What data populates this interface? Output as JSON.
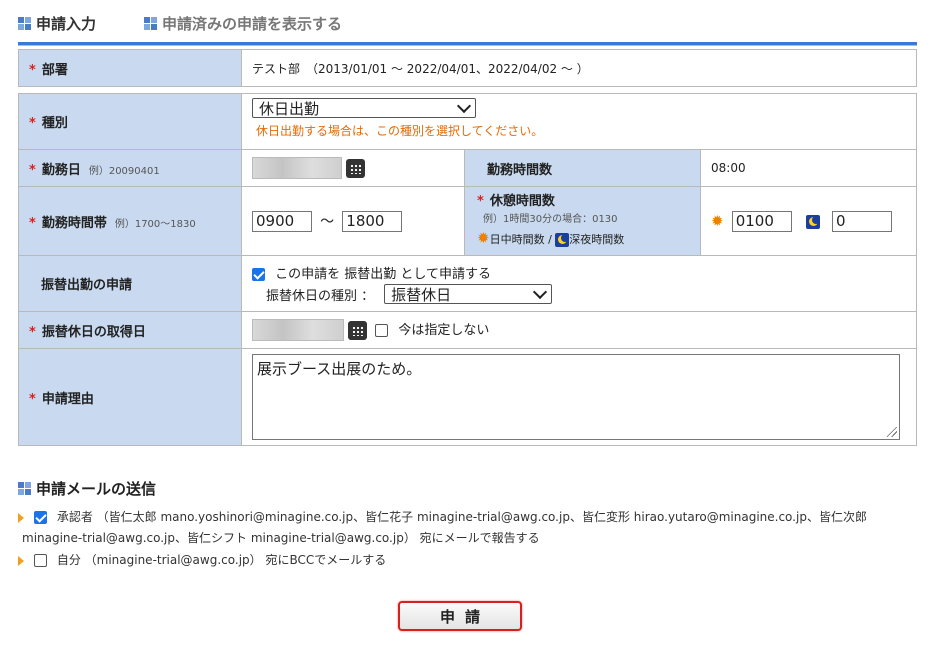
{
  "tabs": {
    "input": "申請入力",
    "submitted": "申請済みの申請を表示する"
  },
  "dept": {
    "label": "部署",
    "value": "テスト部　（2013/01/01 ～ 2022/04/01、2022/04/02 ～ ）"
  },
  "kind": {
    "label": "種別",
    "selected": "休日出勤",
    "note": "休日出勤する場合は、この種別を選択してください。"
  },
  "workday": {
    "label": "勤務日",
    "hint": "例）20090401"
  },
  "workhours": {
    "label": "勤務時間数",
    "value": "08:00"
  },
  "timeband": {
    "label": "勤務時間帯",
    "hint": "例）1700～1830",
    "start": "0900",
    "sep": "～",
    "end": "1800"
  },
  "break": {
    "label": "休憩時間数",
    "hint": "例）1時間30分の場合：0130",
    "day_label": "日中時間数",
    "slash": "/",
    "night_label": "深夜時間数",
    "day_value": "0100",
    "night_value": "0"
  },
  "substitute": {
    "label": "振替出勤の申請",
    "check_text": "この申請を 振替出勤 として申請する",
    "kind_label": "振替休日の種別 ：",
    "kind_value": "振替休日"
  },
  "subday": {
    "label": "振替休日の取得日",
    "no_specify": "今は指定しない"
  },
  "reason": {
    "label": "申請理由",
    "value": "展示ブース出展のため。"
  },
  "mail": {
    "title": "申請メールの送信",
    "approver_line1": "承認者 （皆仁太郎 mano.yoshinori@minagine.co.jp、皆仁花子 minagine-trial@awg.co.jp、皆仁変形 hirao.yutaro@minagine.co.jp、皆仁次郎",
    "approver_line2": "minagine-trial@awg.co.jp、皆仁シフト minagine-trial@awg.co.jp） 宛にメールで報告する",
    "self_line": "自分 （minagine-trial@awg.co.jp） 宛にBCCでメールする"
  },
  "submit_label": "申請",
  "colors": {
    "label_bg": "#c9daf0",
    "required": "#d9201c",
    "accent": "#3b78d8",
    "note": "#e36c09"
  }
}
